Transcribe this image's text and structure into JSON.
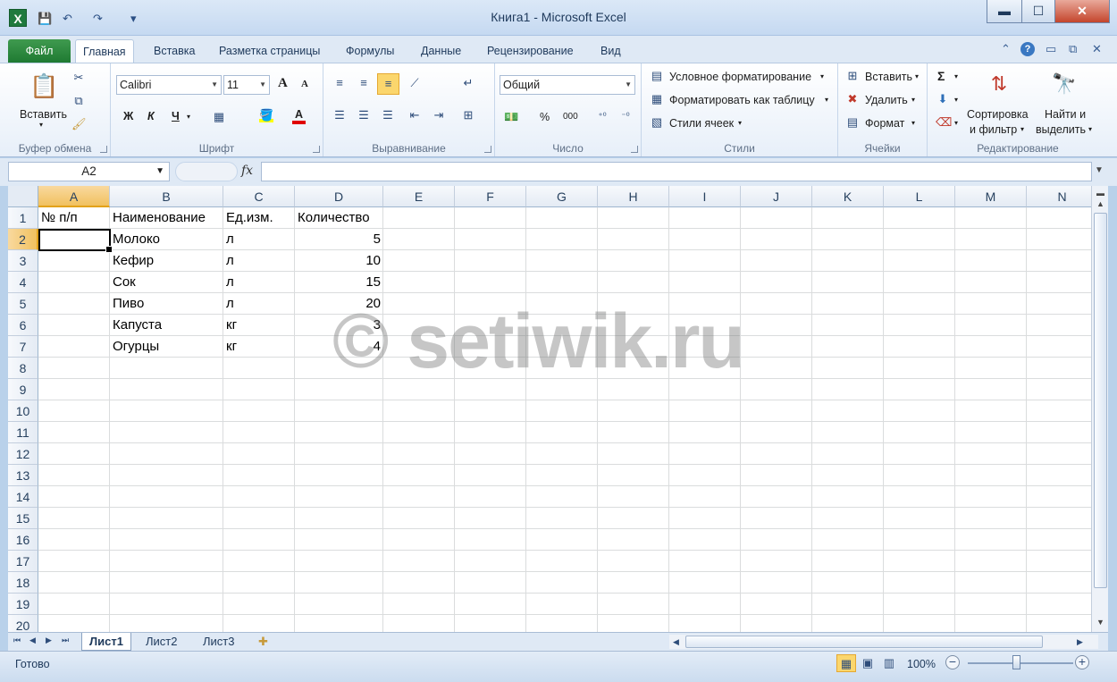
{
  "window": {
    "title": "Книга1 - Microsoft Excel",
    "app_icon": "excel-icon",
    "controls": {
      "minimize": "▬",
      "maximize": "☐",
      "close": "✕"
    }
  },
  "quick_access": {
    "save_icon": "💾",
    "undo_icon": "↶",
    "redo_icon": "↷",
    "customize_icon": "▾"
  },
  "tabs": {
    "file": "Файл",
    "items": [
      "Главная",
      "Вставка",
      "Разметка страницы",
      "Формулы",
      "Данные",
      "Рецензирование",
      "Вид"
    ],
    "active": "Главная"
  },
  "ribbon": {
    "clipboard": {
      "paste": "Вставить",
      "label": "Буфер обмена"
    },
    "font": {
      "name": "Calibri",
      "size": "11",
      "bold": "Ж",
      "italic": "К",
      "underline": "Ч",
      "grow": "A",
      "shrink": "A",
      "label": "Шрифт",
      "font_color_letter": "A"
    },
    "alignment": {
      "label": "Выравнивание"
    },
    "number": {
      "format": "Общий",
      "percent": "%",
      "thousands": "000",
      "label": "Число"
    },
    "styles": {
      "conditional": "Условное форматирование",
      "as_table": "Форматировать как таблицу",
      "cell_styles": "Стили ячеек",
      "label": "Стили"
    },
    "cells": {
      "insert": "Вставить",
      "delete": "Удалить",
      "format": "Формат",
      "label": "Ячейки"
    },
    "editing": {
      "sigma": "Σ",
      "sort_line1": "Сортировка",
      "sort_line2": "и фильтр",
      "find_line1": "Найти и",
      "find_line2": "выделить",
      "label": "Редактирование"
    }
  },
  "formula_bar": {
    "name_box": "A2",
    "fx": "fx",
    "value": ""
  },
  "columns": [
    "A",
    "B",
    "C",
    "D",
    "E",
    "F",
    "G",
    "H",
    "I",
    "J",
    "K",
    "L",
    "M",
    "N"
  ],
  "rows": [
    "1",
    "2",
    "3",
    "4",
    "5",
    "6",
    "7",
    "8",
    "9",
    "10",
    "11",
    "12",
    "13",
    "14",
    "15",
    "16",
    "17",
    "18",
    "19",
    "20"
  ],
  "selected": {
    "column": "A",
    "row": "2"
  },
  "table": {
    "headers": [
      "№ п/п",
      "Наименование",
      "Ед.изм.",
      "Количество"
    ],
    "rows": [
      {
        "name": "Молоко",
        "unit": "л",
        "qty": "5"
      },
      {
        "name": "Кефир",
        "unit": "л",
        "qty": "10"
      },
      {
        "name": "Сок",
        "unit": "л",
        "qty": "15"
      },
      {
        "name": "Пиво",
        "unit": "л",
        "qty": "20"
      },
      {
        "name": "Капуста",
        "unit": "кг",
        "qty": "3"
      },
      {
        "name": "Огурцы",
        "unit": "кг",
        "qty": "4"
      }
    ]
  },
  "watermark": "© setiwik.ru",
  "sheets": [
    "Лист1",
    "Лист2",
    "Лист3"
  ],
  "status": {
    "text": "Готово",
    "zoom": "100%"
  }
}
